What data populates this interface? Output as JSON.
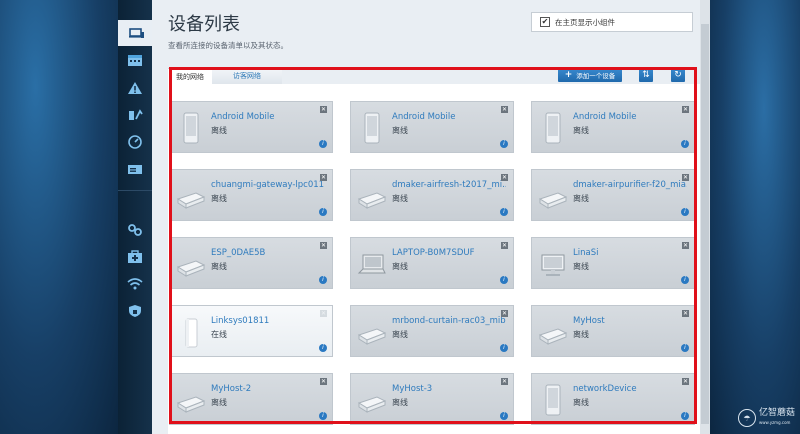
{
  "page": {
    "title": "设备列表",
    "subtitle": "查看所连接的设备清单以及其状态。",
    "widget_checkbox_label": "在主页显示小组件",
    "widget_checked": true
  },
  "tabs": [
    {
      "label": "我的网络",
      "active": true
    },
    {
      "label": "访客网络",
      "active": false
    }
  ],
  "toolbar": {
    "add_device": "添加一个设备",
    "add_icon": "plus-icon",
    "sort_icon": "sort-icon",
    "refresh_icon": "refresh-icon"
  },
  "sidebar": {
    "items": [
      {
        "icon": "devices-icon",
        "active": true
      },
      {
        "icon": "calendar-icon",
        "active": false
      },
      {
        "icon": "warning-icon",
        "active": false
      },
      {
        "icon": "priority-icon",
        "active": false
      },
      {
        "icon": "speedtest-icon",
        "active": false
      },
      {
        "icon": "storage-icon",
        "active": false
      },
      {
        "icon": "settings-icon",
        "active": false
      },
      {
        "icon": "troubleshooting-icon",
        "active": false
      },
      {
        "icon": "wifi-icon",
        "active": false
      },
      {
        "icon": "security-icon",
        "active": false
      }
    ]
  },
  "devices": [
    {
      "name": "Android Mobile",
      "status": "离线",
      "type": "phone",
      "online": false
    },
    {
      "name": "Android Mobile",
      "status": "离线",
      "type": "phone",
      "online": false
    },
    {
      "name": "Android Mobile",
      "status": "离线",
      "type": "phone",
      "online": false
    },
    {
      "name": "chuangmi-gateway-lpc011...",
      "status": "离线",
      "type": "box",
      "online": false
    },
    {
      "name": "dmaker-airfresh-t2017_mi...",
      "status": "离线",
      "type": "box",
      "online": false
    },
    {
      "name": "dmaker-airpurifier-f20_mia...",
      "status": "离线",
      "type": "box",
      "online": false
    },
    {
      "name": "ESP_0DAE5B",
      "status": "离线",
      "type": "box",
      "online": false
    },
    {
      "name": "LAPTOP-B0M7SDUF",
      "status": "离线",
      "type": "laptop",
      "online": false
    },
    {
      "name": "LinaSi",
      "status": "离线",
      "type": "desktop",
      "online": false
    },
    {
      "name": "Linksys01811",
      "status": "在线",
      "type": "router",
      "online": true
    },
    {
      "name": "mrbond-curtain-rac03_mib...",
      "status": "离线",
      "type": "box",
      "online": false
    },
    {
      "name": "MyHost",
      "status": "离线",
      "type": "box",
      "online": false
    },
    {
      "name": "MyHost-2",
      "status": "离线",
      "type": "box",
      "online": false
    },
    {
      "name": "MyHost-3",
      "status": "离线",
      "type": "box",
      "online": false
    },
    {
      "name": "networkDevice",
      "status": "离线",
      "type": "phone",
      "online": false
    }
  ],
  "watermark": {
    "text": "亿智蘑菇",
    "sub": "www.yzmg.com"
  },
  "colors": {
    "accent": "#2f7bbd",
    "highlight": "#e0101a",
    "panel": "#e9eef3"
  }
}
